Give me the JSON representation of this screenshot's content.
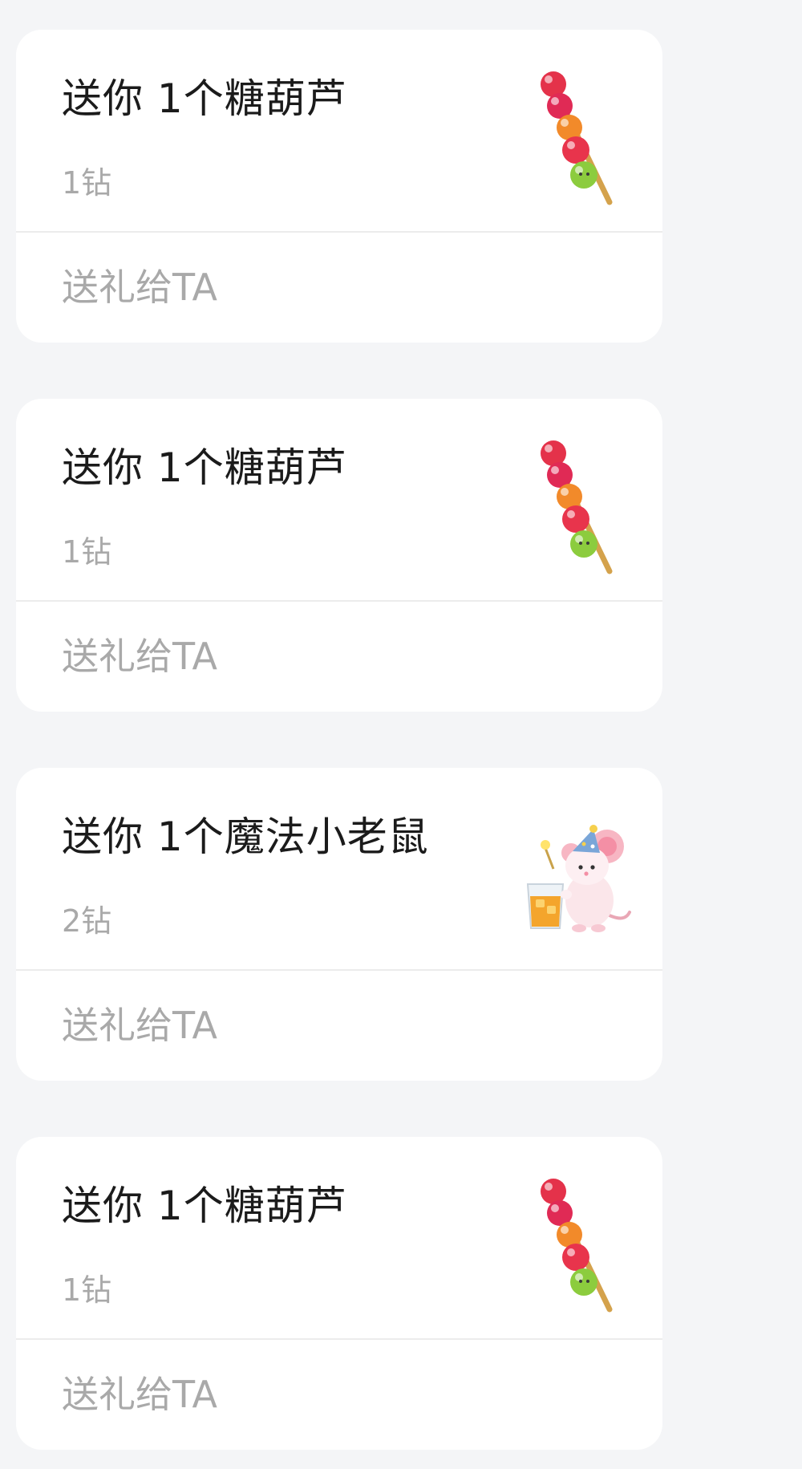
{
  "feed": {
    "cards": [
      {
        "title": "送你 1个糖葫芦",
        "price": "1钻",
        "icon": "candied-haws-icon",
        "action_label": "送礼给TA"
      },
      {
        "title": "送你 1个糖葫芦",
        "price": "1钻",
        "icon": "candied-haws-icon",
        "action_label": "送礼给TA"
      },
      {
        "title": "送你 1个魔法小老鼠",
        "price": "2钻",
        "icon": "magic-mouse-icon",
        "action_label": "送礼给TA"
      },
      {
        "title": "送你 1个糖葫芦",
        "price": "1钻",
        "icon": "candied-haws-icon",
        "action_label": "送礼给TA"
      }
    ]
  },
  "colors": {
    "page_background": "#f4f5f7",
    "card_background": "#ffffff",
    "title_text": "#1b1b1b",
    "muted_text": "#a9a9a9",
    "divider": "#ececec"
  }
}
